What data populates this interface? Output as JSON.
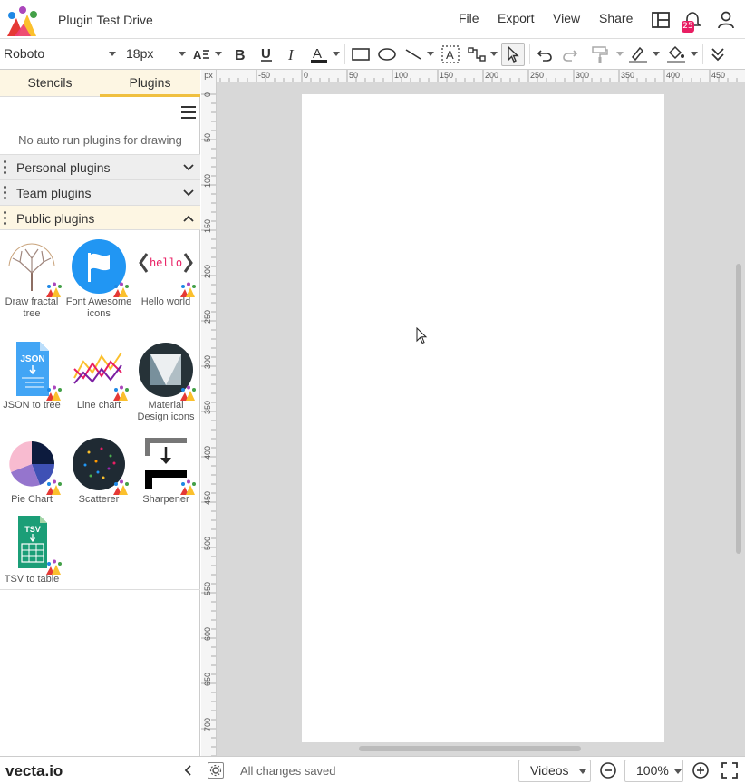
{
  "app": {
    "title": "Plugin Test Drive",
    "menus": [
      "File",
      "Export",
      "View",
      "Share"
    ],
    "notification_count": "25",
    "colors": {
      "accent": "#f0c040",
      "badge": "#e91e63",
      "canvas_bg": "#d8d8d8"
    }
  },
  "toolbar": {
    "font_family": "Roboto",
    "font_size": "18px",
    "icons": [
      "text-align-icon",
      "bold-icon",
      "underline-icon",
      "italic-icon",
      "text-color-icon",
      "rectangle-icon",
      "ellipse-icon",
      "line-icon",
      "textbox-icon",
      "pointer-icon",
      "connector-icon",
      "undo-icon",
      "redo-icon",
      "format-painter-icon",
      "stroke-color-icon",
      "fill-color-icon",
      "more-icon"
    ]
  },
  "sidebar": {
    "tabs": [
      {
        "label": "Stencils",
        "active": false
      },
      {
        "label": "Plugins",
        "active": true
      }
    ],
    "no_auto_text": "No auto run plugins for drawing",
    "sections": [
      {
        "label": "Personal plugins",
        "open": false
      },
      {
        "label": "Team plugins",
        "open": false
      },
      {
        "label": "Public plugins",
        "open": true
      }
    ],
    "plugins": [
      {
        "name": "Draw fractal tree",
        "icon": "fractal-tree-icon"
      },
      {
        "name": "Font Awesome icons",
        "icon": "flag-icon"
      },
      {
        "name": "Hello world",
        "icon": "hello-code-icon"
      },
      {
        "name": "JSON to tree",
        "icon": "json-file-icon"
      },
      {
        "name": "Line chart",
        "icon": "line-chart-icon"
      },
      {
        "name": "Material Design icons",
        "icon": "material-design-icon"
      },
      {
        "name": "Pie Chart",
        "icon": "pie-chart-icon"
      },
      {
        "name": "Scatterer",
        "icon": "scatter-icon"
      },
      {
        "name": "Sharpener",
        "icon": "sharpener-icon"
      },
      {
        "name": "TSV to table",
        "icon": "tsv-file-icon"
      }
    ]
  },
  "ruler": {
    "unit": "px",
    "h_ticks": [
      "-50",
      "0",
      "50",
      "100",
      "150",
      "200",
      "250",
      "300",
      "350",
      "400",
      "450"
    ],
    "v_ticks": [
      "0",
      "50",
      "100",
      "150",
      "200",
      "250",
      "300",
      "350",
      "400",
      "450",
      "500",
      "550",
      "600",
      "650",
      "700"
    ]
  },
  "statusbar": {
    "brand": "vecta.io",
    "status": "All changes saved",
    "videos_label": "Videos",
    "zoom": "100%"
  }
}
